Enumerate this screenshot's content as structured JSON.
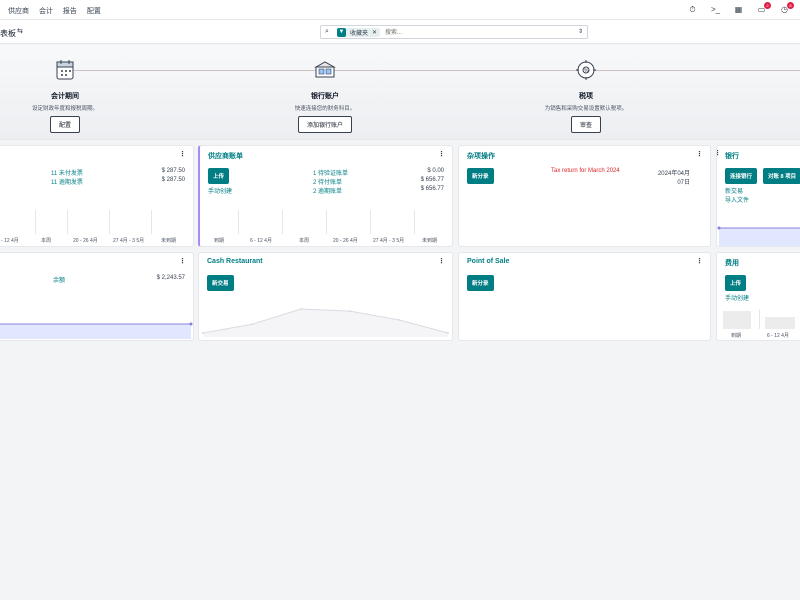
{
  "nav": {
    "items": [
      "供应商",
      "会计",
      "报告",
      "配置"
    ]
  },
  "system_tray": {
    "icons": [
      "clock-icon",
      "terminal-icon",
      "chat-icon",
      "activity-icon",
      "grid-icon"
    ],
    "chat_badge": "2",
    "activity_badge": "8"
  },
  "control": {
    "title": "表板",
    "search_facet": "收藏夹",
    "search_placeholder": "搜索..."
  },
  "onboarding": {
    "steps": [
      {
        "name": "会计期间",
        "desc": "设定财政年度和报税周期。",
        "button": "配置"
      },
      {
        "name": "银行账户",
        "desc": "快速连接您的财务科目。",
        "button": "添加银行账户"
      },
      {
        "name": "税项",
        "desc": "为销售和采购交易设置默认税项。",
        "button": "审查"
      }
    ]
  },
  "cards": {
    "sales": {
      "links": [
        "11 未付发票",
        "11 逾期发票"
      ],
      "amounts": [
        "$ 287.50",
        "$ 287.50"
      ],
      "axis": [
        "- 12 4月",
        "本周",
        "20 - 26 4月",
        "27 4月 - 3 5月",
        "未到期"
      ]
    },
    "vendor_bills": {
      "title": "供应商账单",
      "upload": "上传",
      "manual": "手动创建",
      "links": [
        "1 待验证账单",
        "2 待付账单",
        "2 逾期账单"
      ],
      "amounts": [
        "$ 0.00",
        "$ 656.77",
        "$ 656.77"
      ],
      "axis": [
        "到期",
        "6 - 12 4月",
        "本周",
        "20 - 26 4月",
        "27 4月 - 3 5月",
        "未到期"
      ]
    },
    "misc": {
      "title": "杂项操作",
      "new": "新分录",
      "warning": "Tax return for March 2024",
      "date1": "2024年04月",
      "date2": "07日"
    },
    "bank": {
      "title": "银行",
      "connect": "连接银行",
      "reconcile": "对账 8 项目",
      "new_tx": "新交易",
      "import": "导入文件"
    },
    "cash": {
      "link": "余额",
      "amount": "$ 2,243.57"
    },
    "cash_restaurant": {
      "title": "Cash Restaurant",
      "new": "新交易",
      "trend": [
        14,
        18,
        25,
        24,
        20,
        14
      ]
    },
    "pos": {
      "title": "Point of Sale",
      "new": "新分录"
    },
    "expenses": {
      "title": "费用",
      "upload": "上传",
      "manual": "手动创建",
      "axis": [
        "到期",
        "6 - 12 4月"
      ]
    }
  }
}
